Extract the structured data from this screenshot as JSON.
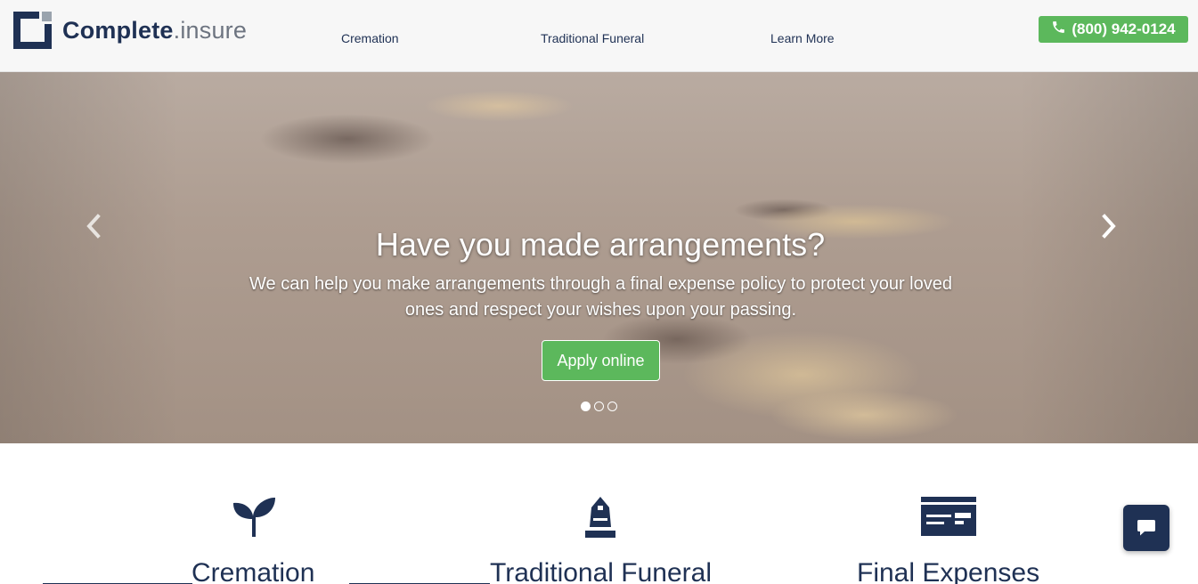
{
  "brand": {
    "name_bold": "Complete",
    "name_light": ".insure",
    "primary_color": "#1f3154",
    "accent_color": "#5cb85c"
  },
  "nav": {
    "links": [
      {
        "label": "Cremation"
      },
      {
        "label": "Traditional Funeral"
      },
      {
        "label": "Learn More"
      }
    ],
    "phone": {
      "label": "(800) 942-0124",
      "icon": "phone-icon"
    }
  },
  "hero": {
    "title": "Have you made arrangements?",
    "text": "We can help you make arrangements through a final expense policy to protect your loved ones and respect your wishes upon your passing.",
    "cta_label": "Apply online",
    "slide_count": 3,
    "active_slide": 1
  },
  "features": [
    {
      "label": "Cremation",
      "icon": "sprout-icon"
    },
    {
      "label": "Traditional Funeral",
      "icon": "headstone-icon"
    },
    {
      "label": "Final Expenses",
      "icon": "bill-card-icon"
    }
  ],
  "chat": {
    "icon": "chat-bubble-icon"
  }
}
